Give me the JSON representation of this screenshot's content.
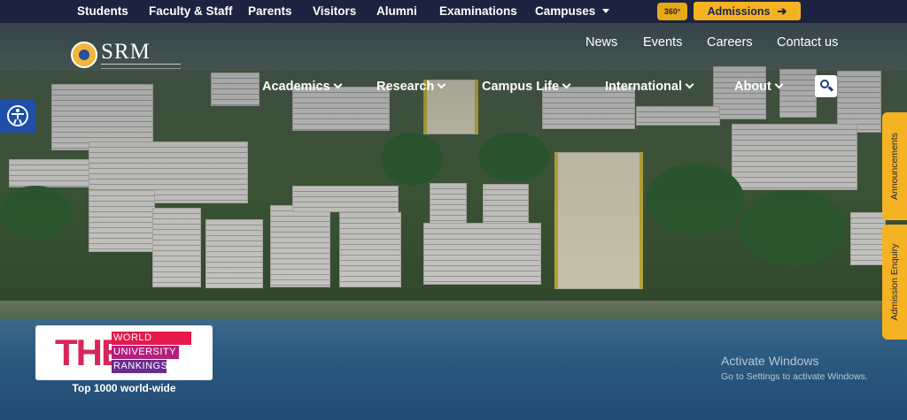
{
  "topbar": {
    "items": [
      "Students",
      "Faculty & Staff",
      "Parents",
      "Visitors",
      "Alumni",
      "Examinations",
      "Campuses"
    ],
    "badge_360": "360°",
    "admissions_label": "Admissions"
  },
  "logo": {
    "name": "SRM"
  },
  "utility_nav": [
    "News",
    "Events",
    "Careers",
    "Contact us"
  ],
  "main_nav": [
    "Academics",
    "Research",
    "Campus Life",
    "International",
    "About"
  ],
  "side_tabs": [
    "Announcements",
    "Admission Enquiry"
  ],
  "rankings": {
    "letters": "THE",
    "lines": [
      "WORLD",
      "UNIVERSITY",
      "RANKINGS"
    ],
    "caption": "Top 1000 world-wide"
  },
  "windows_notice": {
    "title": "Activate Windows",
    "subtitle": "Go to Settings to activate Windows."
  },
  "colors": {
    "topbar_bg": "#1c2340",
    "accent": "#f5b324",
    "access_bg": "#1e4ea8",
    "the_red": "#d7265a"
  },
  "icons": [
    "accessibility-icon",
    "search-icon",
    "arrow-right-icon",
    "chevron-down-icon",
    "caret-down-icon",
    "logo-seal-icon"
  ]
}
